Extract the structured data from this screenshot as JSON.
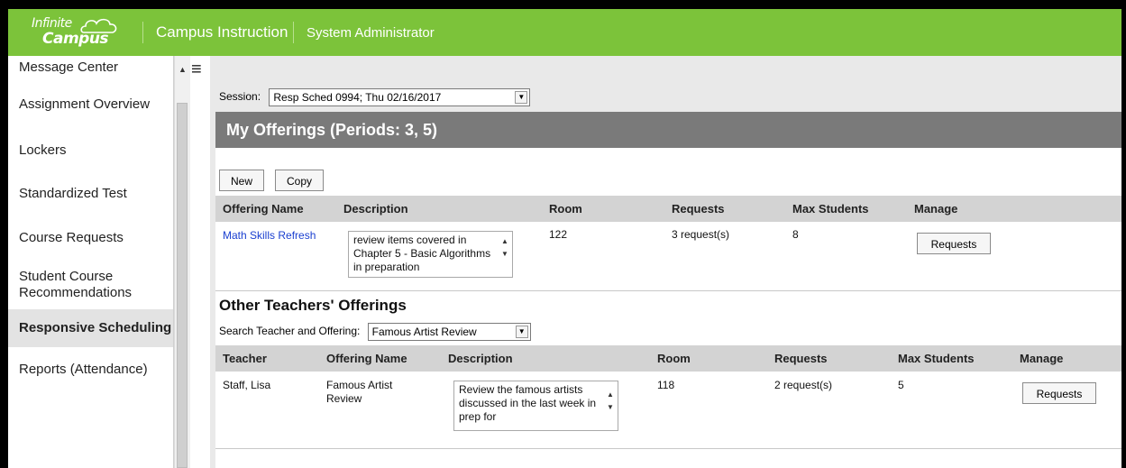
{
  "header": {
    "logo_line1": "Infinite",
    "logo_line2": "Campus",
    "app_name": "Campus Instruction",
    "user_role": "System Administrator"
  },
  "sidebar": {
    "items": [
      {
        "label": "Message Center"
      },
      {
        "label": "Assignment Overview"
      },
      {
        "label": "Lockers"
      },
      {
        "label": "Standardized Test"
      },
      {
        "label": "Course Requests"
      },
      {
        "label": "Student Course Recommendations"
      },
      {
        "label": "Responsive Scheduling",
        "active": true
      },
      {
        "label": "Reports (Attendance)"
      }
    ]
  },
  "session": {
    "label": "Session:",
    "value": "Resp Sched 0994; Thu 02/16/2017"
  },
  "my_offerings": {
    "title": "My Offerings (Periods: 3, 5)",
    "new_label": "New",
    "copy_label": "Copy",
    "columns": [
      "Offering Name",
      "Description",
      "Room",
      "Requests",
      "Max Students",
      "Manage"
    ],
    "rows": [
      {
        "offering_name": "Math Skills Refresh",
        "description": "review items covered in Chapter 5 - Basic Algorithms in preparation",
        "room": "122",
        "requests": "3 request(s)",
        "max_students": "8",
        "manage_label": "Requests"
      }
    ]
  },
  "other_offerings": {
    "title": "Other Teachers' Offerings",
    "search_label": "Search Teacher and Offering:",
    "search_value": "Famous Artist Review",
    "columns": [
      "Teacher",
      "Offering Name",
      "Description",
      "Room",
      "Requests",
      "Max Students",
      "Manage"
    ],
    "rows": [
      {
        "teacher": "Staff, Lisa",
        "offering_name": "Famous Artist Review",
        "description": "Review the famous artists discussed in the last week in prep for",
        "room": "118",
        "requests": "2 request(s)",
        "max_students": "5",
        "manage_label": "Requests"
      }
    ]
  },
  "colors": {
    "header_green": "#7cc33a",
    "section_header_gray": "#7a7a7a",
    "link_blue": "#1a3fd0"
  },
  "icons": {
    "menu": "hamburger-icon",
    "logo": "campus-cloud-logo",
    "dropdown": "chevron-down-icon"
  }
}
